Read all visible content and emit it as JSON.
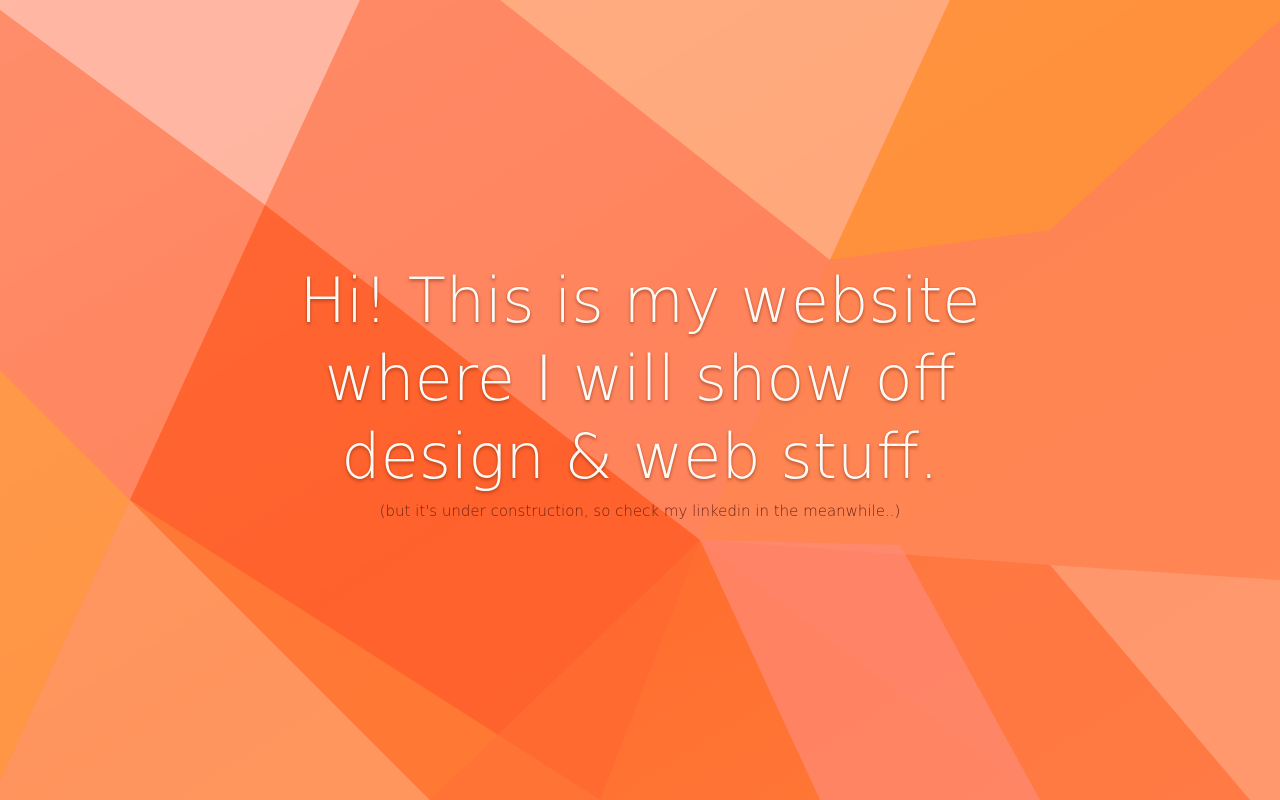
{
  "hero": {
    "headline_lines": [
      "Hi! This is my website",
      "where I will show off",
      "design & web stuff."
    ],
    "subtext": "(but it's under construction, so check my linkedin in the meanwhile..)"
  },
  "colors": {
    "bg_base": "#ff7a3a",
    "bg_deep": "#ff5e2a",
    "bg_light": "#ffb08a",
    "bg_pink": "#ff8c7f",
    "bg_peach": "#ffc3a8",
    "text_light": "#fff8f3",
    "text_dark": "#6e2410"
  }
}
